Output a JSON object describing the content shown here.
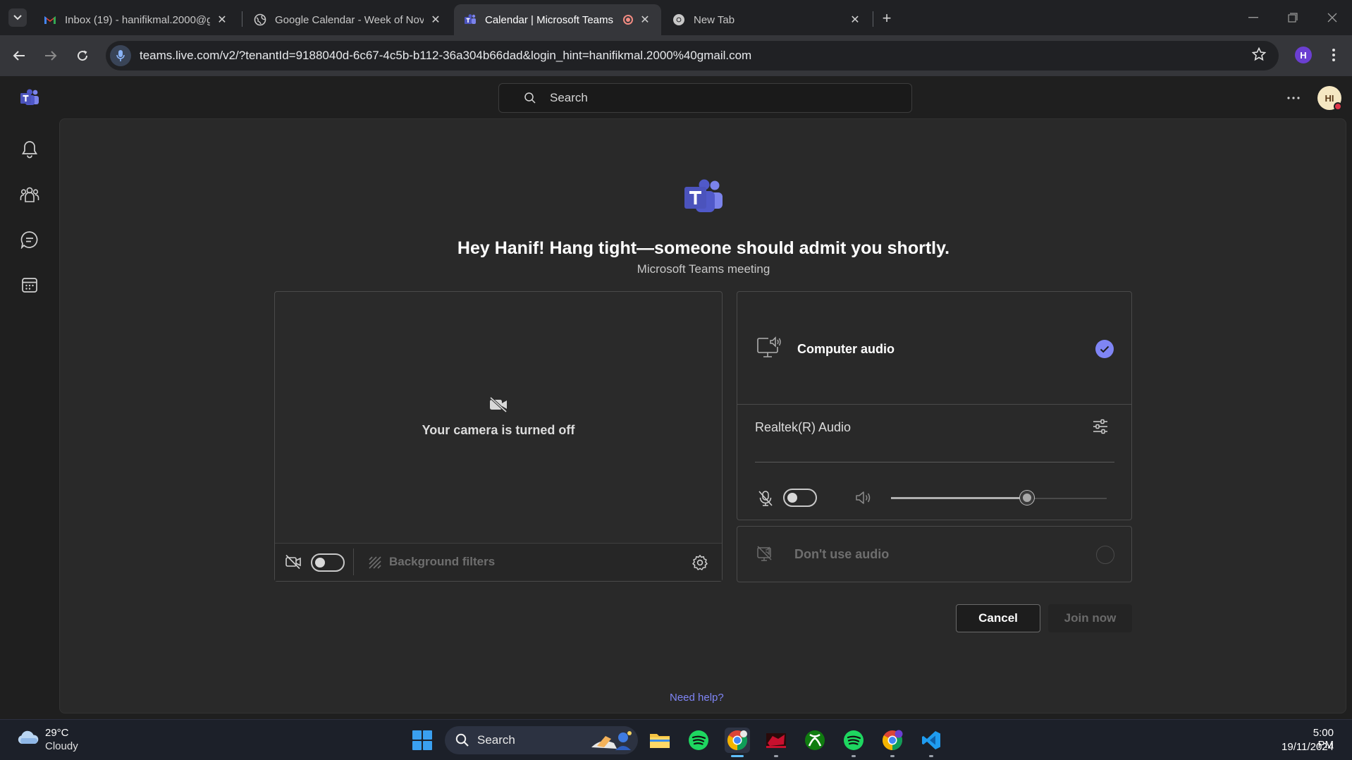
{
  "browser": {
    "tabs": [
      {
        "title": "Inbox (19) - hanifikmal.2000@g",
        "icon": "gmail-icon"
      },
      {
        "title": "Google Calendar - Week of Nov",
        "icon": "globe-icon"
      },
      {
        "title": "Calendar | Microsoft Teams",
        "icon": "teams-icon",
        "active": true
      },
      {
        "title": "New Tab",
        "icon": "chrome-icon"
      }
    ],
    "url": "teams.live.com/v2/?tenantId=9188040d-6c67-4c5b-b112-36a304b66dad&login_hint=hanifikmal.2000%40gmail.com",
    "profile_initial": "H"
  },
  "teams": {
    "search_placeholder": "Search",
    "avatar_initials": "HI",
    "headline": "Hey Hanif! Hang tight—someone should admit you shortly.",
    "subline": "Microsoft Teams meeting",
    "camera_off_text": "Your camera is turned off",
    "background_filters": "Background filters",
    "computer_audio": "Computer audio",
    "audio_device": "Realtek(R) Audio",
    "volume_percent": 63,
    "dont_use_audio": "Don't use audio",
    "cancel": "Cancel",
    "join_now": "Join now",
    "need_help": "Need help?",
    "accent_color": "#7f85f5"
  },
  "taskbar": {
    "temperature": "29°C",
    "condition": "Cloudy",
    "search_label": "Search",
    "time": "5:00 PM",
    "date": "19/11/2024"
  }
}
